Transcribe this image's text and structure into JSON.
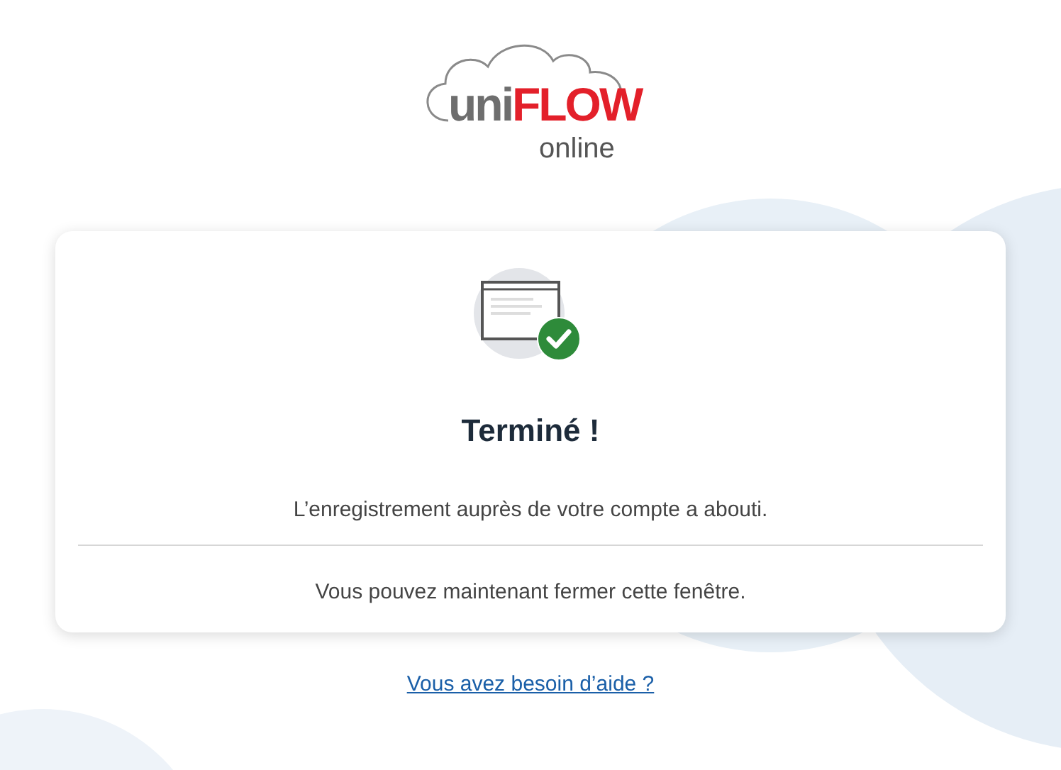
{
  "logo": {
    "prefix": "uni",
    "brand": "FLOW",
    "suffix": "online"
  },
  "card": {
    "title": "Terminé !",
    "message": "L’enregistrement auprès de votre compte a abouti.",
    "note": "Vous pouvez maintenant fermer cette fenêtre."
  },
  "help_link": "Vous avez besoin d’aide ?"
}
